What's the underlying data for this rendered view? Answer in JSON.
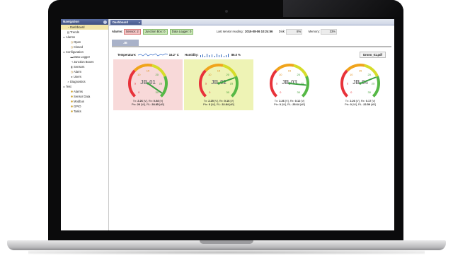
{
  "sidebar": {
    "title": "Navigation",
    "items": [
      {
        "label": "Dashboard",
        "icon": "dashboard-icon",
        "level": 1,
        "selected": true
      },
      {
        "label": "Trends",
        "icon": "chart-icon",
        "level": 1
      },
      {
        "label": "Alarms",
        "icon": "folder-icon",
        "level": 0
      },
      {
        "label": "Open",
        "icon": "alarm-icon",
        "level": 2
      },
      {
        "label": "Closed",
        "icon": "alarm-icon",
        "level": 2
      },
      {
        "label": "Configuration",
        "icon": "folder-icon",
        "level": 0
      },
      {
        "label": "Data Logger",
        "icon": "logger-icon",
        "level": 2
      },
      {
        "label": "Junction Boxes",
        "icon": "junction-icon",
        "level": 2
      },
      {
        "label": "Sensors",
        "icon": "sensor-icon",
        "level": 2
      },
      {
        "label": "Alarm",
        "icon": "alarm-icon",
        "level": 2
      },
      {
        "label": "Users",
        "icon": "user-icon",
        "level": 2
      },
      {
        "label": "Diagnostics",
        "icon": "search-icon",
        "level": 1
      },
      {
        "label": "Test",
        "icon": "folder-icon",
        "level": 0
      },
      {
        "label": "Alarms",
        "icon": "gear-icon",
        "level": 2
      },
      {
        "label": "Sensor Data",
        "icon": "gear-icon",
        "level": 2
      },
      {
        "label": "Modbus",
        "icon": "gear-icon",
        "level": 2
      },
      {
        "label": "GPIO",
        "icon": "gear-icon",
        "level": 2
      },
      {
        "label": "Tasks",
        "icon": "gear-icon",
        "level": 2
      }
    ]
  },
  "tab": {
    "label": "Dashboard"
  },
  "status": {
    "alarms_label": "Alarms:",
    "sensor_label": "Sensor: 2",
    "jbox_label": "Junction Box: 0",
    "logger_label": "Data Logger: 0",
    "last_reading_label": "Last sensor reading :",
    "last_reading_value": "2015-08-06 10:24:56",
    "disk_label": "Disk:",
    "disk_value": "8%",
    "memory_label": "Memory:",
    "memory_value": "33%"
  },
  "subtab": {
    "label": "JB"
  },
  "sensors": {
    "temperature_label": "Temperature:",
    "temperature_value": "16.2° C",
    "humidity_label": "Humidity:",
    "humidity_value": "86.0 %",
    "pdf_label": "Grono_01.pdf"
  },
  "colors": {
    "alarm_red": "#f8d9d9",
    "warning_yellow": "#eef3b5"
  },
  "gauges": [
    {
      "name": "JB-01",
      "value": 28.85,
      "tx": "2.26",
      "rx": "0.08",
      "ptx": "20",
      "rl": "28.85"
    },
    {
      "name": "JB-02",
      "value": 22.84,
      "tx": "2.25",
      "rx": "0.16",
      "ptx": "0",
      "rl": "22.84"
    },
    {
      "name": "JB-03",
      "value": 25.64,
      "tx": "2.26",
      "rx": "0.12",
      "ptx": "0",
      "rl": "25.64"
    },
    {
      "name": "JB-04",
      "value": 22.59,
      "tx": "2.26",
      "rx": "0.17",
      "ptx": "0",
      "rl": "22.59"
    }
  ],
  "gauge_scale": {
    "min": 0,
    "max": 30,
    "ticks": [
      "0",
      "5",
      "10",
      "15",
      "20",
      "25",
      "30"
    ]
  },
  "caption_units": {
    "tx": "Tx:",
    "rx": ", Rx:",
    "v": "[V]",
    "ptx": "Ptx:",
    "w": "[W], RL:",
    "db": "[dB]"
  }
}
